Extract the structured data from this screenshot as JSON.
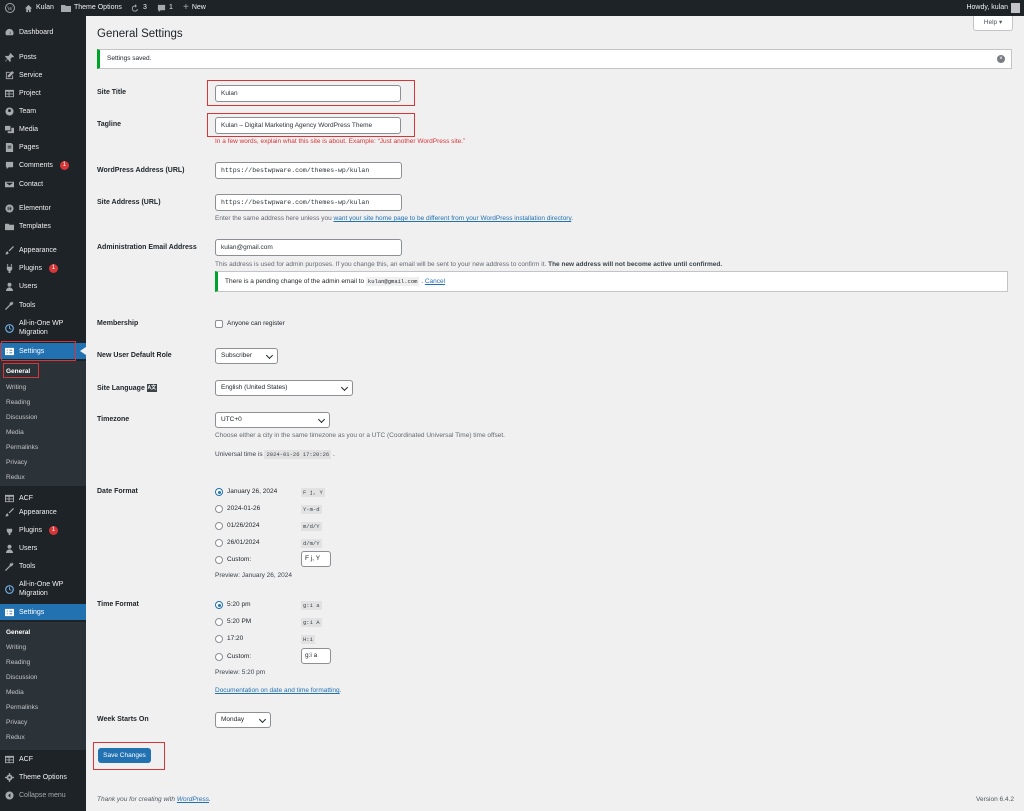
{
  "adminbar": {
    "site": "Kulan",
    "theme_options": "Theme Options",
    "updates": "3",
    "comments": "1",
    "new": "New",
    "howdy": "Howdy, kulan"
  },
  "menu": {
    "items": [
      {
        "label": "Dashboard"
      },
      {
        "label": "Posts"
      },
      {
        "label": "Service"
      },
      {
        "label": "Project"
      },
      {
        "label": "Team"
      },
      {
        "label": "Media"
      },
      {
        "label": "Pages"
      },
      {
        "label": "Comments",
        "badge": "1"
      },
      {
        "label": "Contact"
      },
      {
        "label": "Elementor"
      },
      {
        "label": "Templates"
      },
      {
        "label": "Appearance"
      },
      {
        "label": "Plugins",
        "badge": "1"
      },
      {
        "label": "Users"
      },
      {
        "label": "Tools"
      },
      {
        "label": "All-in-One WP Migration"
      },
      {
        "label": "Settings"
      }
    ],
    "settings_sub": [
      "General",
      "Writing",
      "Reading",
      "Discussion",
      "Media",
      "Permalinks",
      "Privacy",
      "Redux"
    ],
    "items2": [
      {
        "label": "ACF"
      },
      {
        "label": "Appearance"
      },
      {
        "label": "Plugins",
        "badge": "1"
      },
      {
        "label": "Users"
      },
      {
        "label": "Tools"
      },
      {
        "label": "All-in-One WP Migration"
      },
      {
        "label": "Settings"
      }
    ],
    "items3": [
      {
        "label": "ACF"
      },
      {
        "label": "Theme Options"
      },
      {
        "label": "Collapse menu"
      }
    ]
  },
  "page": {
    "title": "General Settings",
    "help": "Help ▾",
    "notice": "Settings saved."
  },
  "form": {
    "site_title_label": "Site Title",
    "site_title": "Kulan",
    "tagline_label": "Tagline",
    "tagline": "Kulan – Digital Marketing Agency WordPress Theme",
    "tagline_desc": "In a few words, explain what this site is about. Example: “Just another WordPress site.”",
    "wp_address_label": "WordPress Address (URL)",
    "wp_address": "https://bestwpware.com/themes-wp/kulan",
    "site_address_label": "Site Address (URL)",
    "site_address": "https://bestwpware.com/themes-wp/kulan",
    "site_address_desc_pre": "Enter the same address here unless you ",
    "site_address_desc_link": "want your site home page to be different from your WordPress installation directory",
    "admin_email_label": "Administration Email Address",
    "admin_email": "kulan@gmail.com",
    "admin_email_desc": "This address is used for admin purposes. If you change this, an email will be sent to your new address to confirm it. ",
    "admin_email_desc_bold": "The new address will not become active until confirmed.",
    "pending_pre": "There is a pending change of the admin email to ",
    "pending_email": "kulan@gmail.com",
    "pending_cancel": "Cancel",
    "membership_label": "Membership",
    "membership_text": "Anyone can register",
    "role_label": "New User Default Role",
    "role": "Subscriber",
    "language_label": "Site Language",
    "language": "English (United States)",
    "timezone_label": "Timezone",
    "timezone": "UTC+0",
    "timezone_desc": "Choose either a city in the same timezone as you or a UTC (Coordinated Universal Time) time offset.",
    "universal_pre": "Universal time is ",
    "universal_time": "2024-01-26 17:20:26",
    "date_label": "Date Format",
    "date_options": [
      {
        "label": "January 26, 2024",
        "code": "F j, Y",
        "checked": true
      },
      {
        "label": "2024-01-26",
        "code": "Y-m-d"
      },
      {
        "label": "01/26/2024",
        "code": "m/d/Y"
      },
      {
        "label": "26/01/2024",
        "code": "d/m/Y"
      },
      {
        "label": "Custom:",
        "code": "F j, Y"
      }
    ],
    "date_preview": "Preview: January 26, 2024",
    "time_label": "Time Format",
    "time_options": [
      {
        "label": "5:20 pm",
        "code": "g:i a",
        "checked": true
      },
      {
        "label": "5:20 PM",
        "code": "g:i A"
      },
      {
        "label": "17:20",
        "code": "H:i"
      },
      {
        "label": "Custom:",
        "code": "g:i a"
      }
    ],
    "time_preview": "Preview: 5:20 pm",
    "time_doc": "Documentation on date and time formatting",
    "week_label": "Week Starts On",
    "week": "Monday",
    "save": "Save Changes"
  },
  "footer": {
    "thanks_pre": "Thank you for creating with ",
    "thanks_link": "WordPress",
    "version": "Version 6.4.2"
  }
}
